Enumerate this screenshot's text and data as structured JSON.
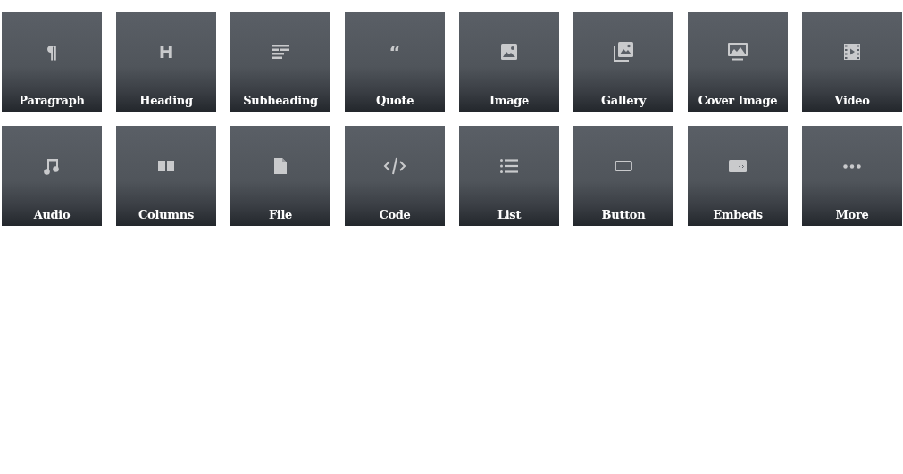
{
  "blocks": [
    {
      "label": "Paragraph",
      "kind": "glyph",
      "glyph": "¶"
    },
    {
      "label": "Heading",
      "kind": "glyph",
      "glyph": "H"
    },
    {
      "label": "Subheading",
      "kind": "subheading"
    },
    {
      "label": "Quote",
      "kind": "glyph",
      "glyph": "“"
    },
    {
      "label": "Image",
      "kind": "image"
    },
    {
      "label": "Gallery",
      "kind": "gallery"
    },
    {
      "label": "Cover Image",
      "kind": "cover"
    },
    {
      "label": "Video",
      "kind": "video"
    },
    {
      "label": "Audio",
      "kind": "audio"
    },
    {
      "label": "Columns",
      "kind": "columns"
    },
    {
      "label": "File",
      "kind": "file"
    },
    {
      "label": "Code",
      "kind": "code"
    },
    {
      "label": "List",
      "kind": "list"
    },
    {
      "label": "Button",
      "kind": "button"
    },
    {
      "label": "Embeds",
      "kind": "embed"
    },
    {
      "label": "More",
      "kind": "more"
    }
  ]
}
